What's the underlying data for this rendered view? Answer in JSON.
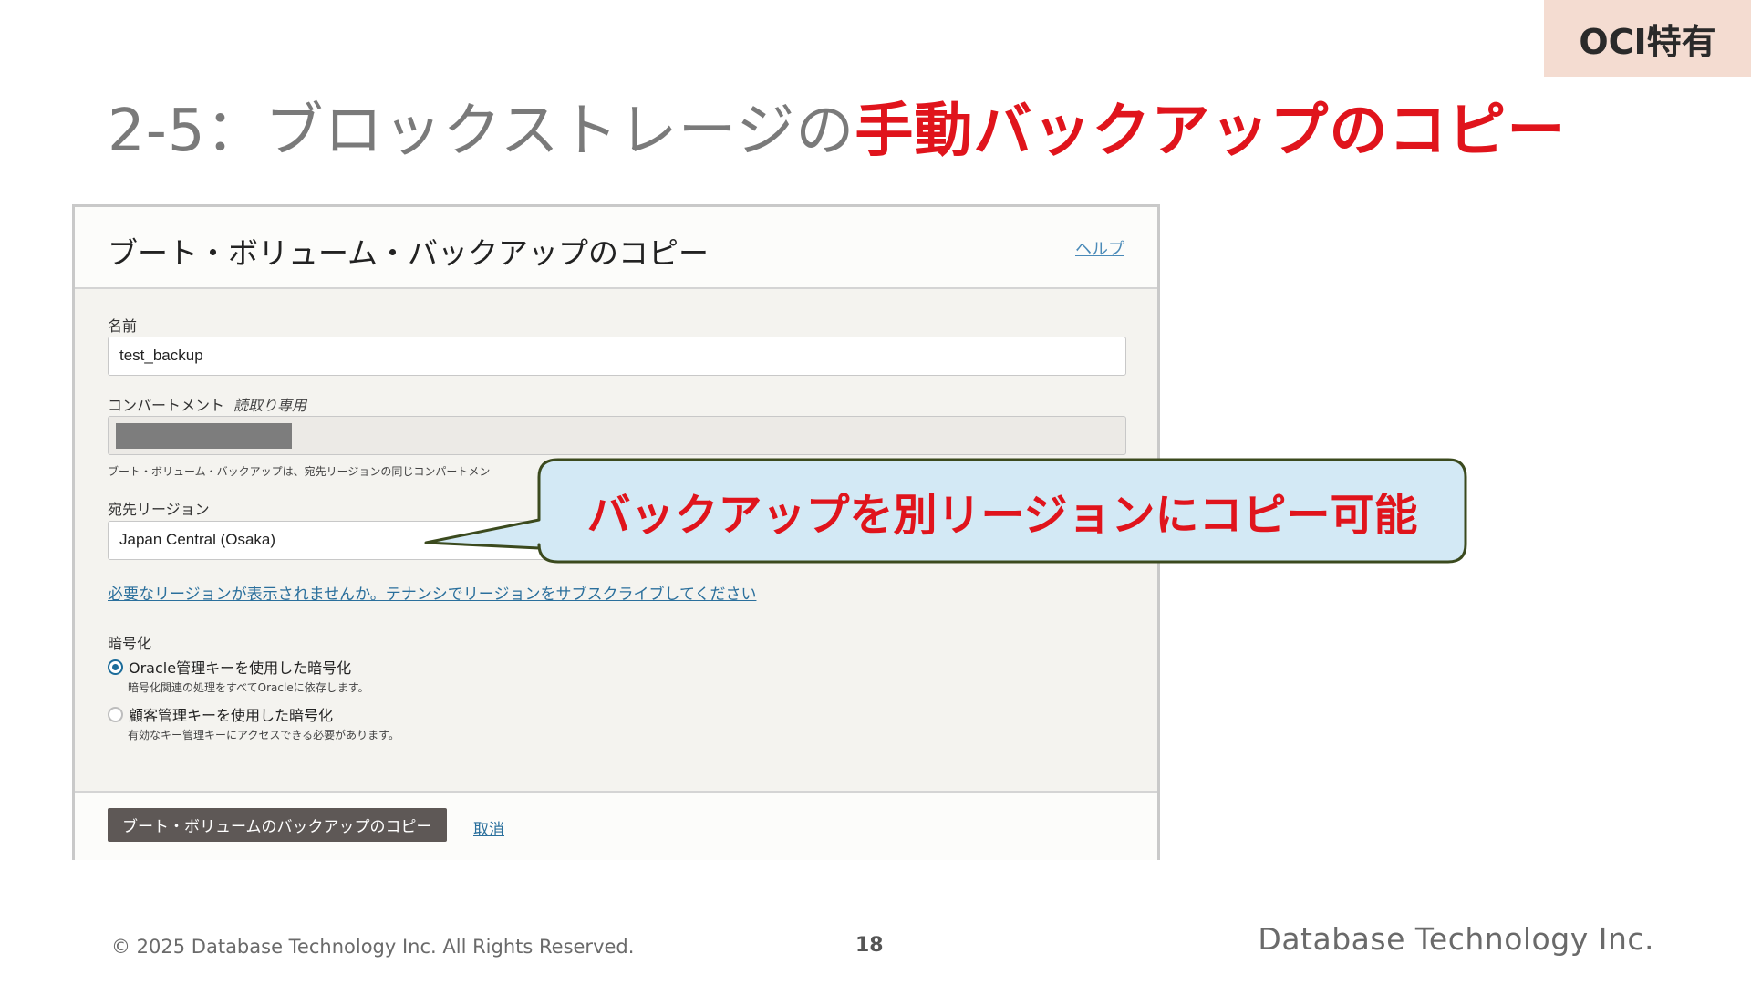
{
  "tag": "OCI特有",
  "slide": {
    "title_prefix": "2-5：ブロックストレージの",
    "title_highlight": "手動バックアップのコピー"
  },
  "dialog": {
    "title": "ブート・ボリューム・バックアップのコピー",
    "help": "ヘルプ",
    "name_label": "名前",
    "name_value": "test_backup",
    "compartment_label": "コンパートメント",
    "compartment_readonly": "読取り専用",
    "compartment_hint": "ブート・ボリューム・バックアップは、宛先リージョンの同じコンパートメン",
    "region_label": "宛先リージョン",
    "region_value": "Japan Central (Osaka)",
    "subscribe_link": "必要なリージョンが表示されませんか。テナンシでリージョンをサブスクライブしてください",
    "encryption_label": "暗号化",
    "options": [
      {
        "label": "Oracle管理キーを使用した暗号化",
        "desc": "暗号化関連の処理をすべてOracleに依存します。",
        "checked": true
      },
      {
        "label": "顧客管理キーを使用した暗号化",
        "desc": "有効なキー管理キーにアクセスできる必要があります。",
        "checked": false
      }
    ],
    "submit": "ブート・ボリュームのバックアップのコピー",
    "cancel": "取消"
  },
  "callout": {
    "text": "バックアップを別リージョンにコピー可能",
    "fill": "#d3e9f5",
    "stroke": "#3b4a1e"
  },
  "footer": {
    "copyright": "© 2025 Database Technology Inc. All Rights Reserved.",
    "page": "18",
    "company": "Database Technology Inc."
  },
  "colors": {
    "accent_red": "#e0141c",
    "tag_bg": "#f4dcd1"
  }
}
